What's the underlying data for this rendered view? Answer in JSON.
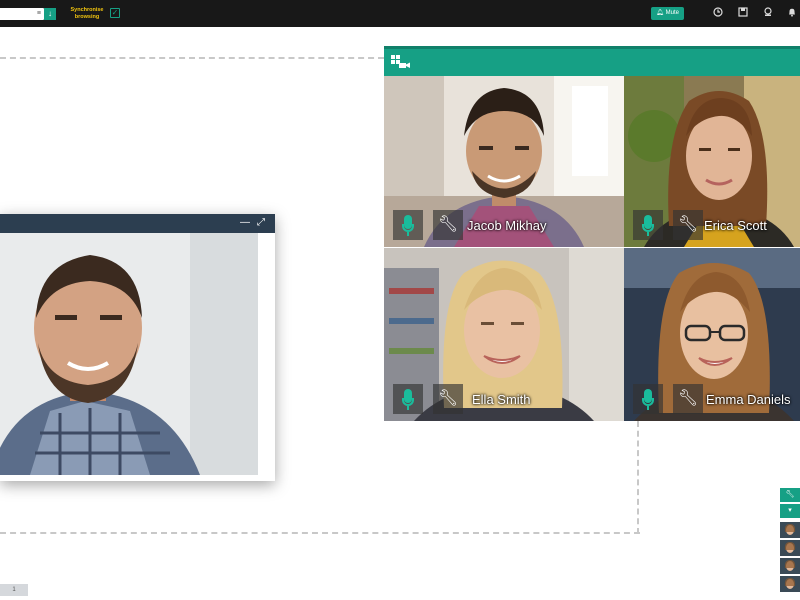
{
  "toolbar": {
    "url_menu_icon": "hamburger-icon",
    "go_icon": "arrow-down-icon",
    "sync_label": "Synchronise browsing",
    "sync_checked": true,
    "mute_label": "Mute",
    "icons": [
      "clock-icon",
      "save-icon",
      "recorder-icon",
      "bell-icon"
    ],
    "accent_color": "#16a085"
  },
  "video_panel": {
    "header_icon": "video-grid-icon",
    "participants": [
      {
        "name": "Jacob Mikhay",
        "mic_icon": "microphone-icon",
        "settings_icon": "wrench-icon"
      },
      {
        "name": "Erica Scott",
        "mic_icon": "microphone-icon",
        "settings_icon": "wrench-icon"
      },
      {
        "name": "Ella Smith",
        "mic_icon": "microphone-icon",
        "settings_icon": "wrench-icon"
      },
      {
        "name": "Emma Daniels",
        "mic_icon": "microphone-icon",
        "settings_icon": "wrench-icon"
      }
    ]
  },
  "floating_window": {
    "minimize_symbol": "—",
    "expand_symbol": "⤢",
    "header_color": "#2c3e50"
  },
  "side_panel": {
    "buttons": [
      "wrench-icon",
      "caret-down-icon"
    ],
    "thumbnail_count": 4
  },
  "page_indicator": {
    "label": "1"
  }
}
